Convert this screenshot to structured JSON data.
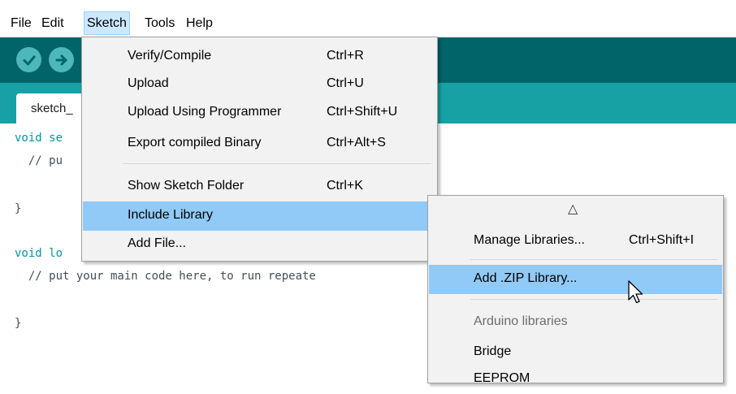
{
  "menubar": {
    "items": [
      "File",
      "Edit",
      "Sketch",
      "Tools",
      "Help"
    ]
  },
  "toolbar": {
    "verify_icon": "checkmark-icon",
    "upload_icon": "right-arrow-icon"
  },
  "tabs": {
    "active_label": "sketch_"
  },
  "editor": {
    "lines": [
      "void se",
      "  // pu",
      "}",
      "void lo",
      "  // put your main code here, to run repeate",
      "}"
    ]
  },
  "sketch_menu": {
    "items": [
      {
        "label": "Verify/Compile",
        "shortcut": "Ctrl+R"
      },
      {
        "label": "Upload",
        "shortcut": "Ctrl+U"
      },
      {
        "label": "Upload Using Programmer",
        "shortcut": "Ctrl+Shift+U"
      },
      {
        "label": "Export compiled Binary",
        "shortcut": "Ctrl+Alt+S"
      },
      {
        "label": "Show Sketch Folder",
        "shortcut": "Ctrl+K"
      },
      {
        "label": "Include Library",
        "shortcut": "",
        "arrow": "›"
      },
      {
        "label": "Add File...",
        "shortcut": ""
      }
    ]
  },
  "include_menu": {
    "scroll_up": "△",
    "items": [
      {
        "label": "Manage Libraries...",
        "shortcut": "Ctrl+Shift+I"
      },
      {
        "label": "Add .ZIP Library...",
        "shortcut": ""
      },
      {
        "label": "Arduino libraries",
        "shortcut": ""
      },
      {
        "label": "Bridge",
        "shortcut": ""
      },
      {
        "label": "EEPROM",
        "shortcut": ""
      }
    ]
  },
  "colors": {
    "toolbar": "#006468",
    "tabstrip": "#17a1a5",
    "toolbar_button": "#4db7bb",
    "menu_highlight": "#91c9f7",
    "keyword": "#00979c"
  }
}
